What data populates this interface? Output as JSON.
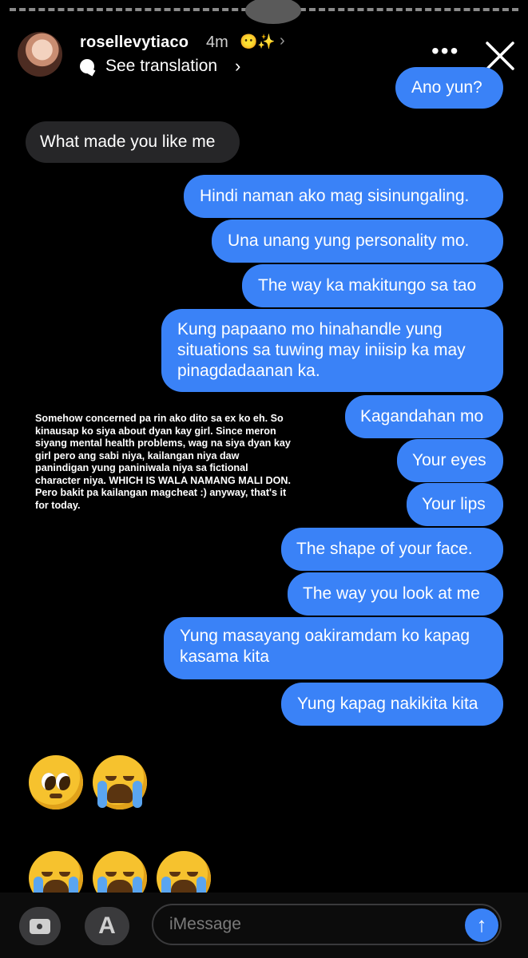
{
  "header": {
    "username": "rosellevytiaco",
    "time_ago": "4m",
    "header_emojis": "😶✨",
    "see_translation": "See translation",
    "more_icon": "more-horizontal-icon",
    "close_icon": "close-icon"
  },
  "messages": [
    {
      "text": "Ano yun?",
      "direction": "outgoing"
    },
    {
      "text": "What made you like me",
      "direction": "incoming"
    },
    {
      "text": "Hindi naman ako mag sisinungaling.",
      "direction": "outgoing"
    },
    {
      "text": "Una unang yung personality mo.",
      "direction": "outgoing"
    },
    {
      "text": "The way ka makitungo sa tao",
      "direction": "outgoing"
    },
    {
      "text": "Kung papaano mo hinahandle yung situations sa tuwing may iniisip ka may pinagdadaanan ka.",
      "direction": "outgoing"
    },
    {
      "text": "Kagandahan mo",
      "direction": "outgoing"
    },
    {
      "text": "Your eyes",
      "direction": "outgoing"
    },
    {
      "text": "Your lips",
      "direction": "outgoing"
    },
    {
      "text": "The shape of your face.",
      "direction": "outgoing"
    },
    {
      "text": "The way you look at me",
      "direction": "outgoing"
    },
    {
      "text": "Yung masayang oakiramdam ko kapag kasama kita",
      "direction": "outgoing"
    },
    {
      "text": "Yung kapag nakikita kita",
      "direction": "outgoing"
    }
  ],
  "caption": "Somehow concerned pa rin ako dito sa ex ko eh. So kinausap ko siya about dyan kay girl. Since meron siyang mental health problems, wag na siya dyan kay girl pero ang sabi niya, kailangan niya daw panindigan yung paniniwala niya sa fictional character niya. WHICH IS WALA NAMANG MALI DON. Pero bakit pa kailangan magcheat :) anyway, that's it for today.",
  "reactions": {
    "row1": [
      "pleading-face",
      "loudly-crying-face"
    ],
    "row2": [
      "loudly-crying-face",
      "loudly-crying-face",
      "loudly-crying-face"
    ]
  },
  "input": {
    "placeholder": "iMessage",
    "camera_icon": "camera-icon",
    "apps_icon": "app-store-icon",
    "send_icon": "send-arrow-icon"
  },
  "colors": {
    "outgoing_bubble": "#3a82f7",
    "incoming_bubble": "#262628",
    "background": "#000000"
  }
}
